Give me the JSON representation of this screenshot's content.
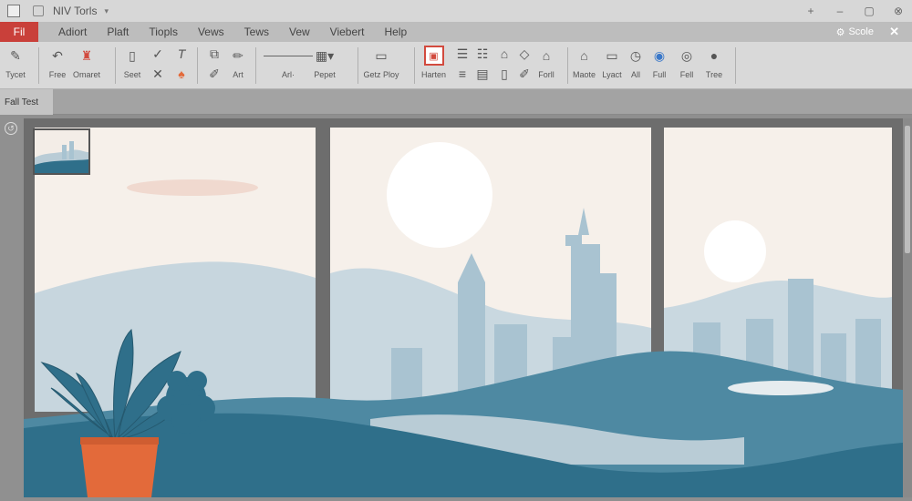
{
  "window": {
    "title": "NIV Torls"
  },
  "menu": {
    "file_tab": "Fil",
    "items": [
      "Adiort",
      "Plaft",
      "Tiopls",
      "Vews",
      "Tews",
      "Vew",
      "Viebert",
      "Help"
    ],
    "scale_label": "Scole"
  },
  "ribbon": {
    "labels": {
      "tycet": "Tycet",
      "free": "Free",
      "omaret": "Omaret",
      "seet": "Seet",
      "art": "Art",
      "arl": "Arl·",
      "pepet": "Pepet",
      "getz_play": "Getz Ploy",
      "harten": "Harten",
      "forll": "Forll",
      "maote": "Maote",
      "lyact": "Lyact",
      "all": "All",
      "full": "Full",
      "fell": "Fell",
      "tree": "Tree"
    }
  },
  "sheet_tab": {
    "label": "Fall Test"
  },
  "colors": {
    "file_tab": "#c9403a",
    "selected_tool": "#d24a3e",
    "frame": "#6d6d6d",
    "sky": "#f6f0ea",
    "teal": "#2f6f8a",
    "teal_light": "#4e89a2",
    "mountain": "#b9ccd6",
    "building": "#a8c3d1",
    "sun": "#ffffff",
    "pot": "#e36a3a",
    "cloud": "#efd6cc"
  },
  "icons": [
    "gear-icon",
    "check-icon",
    "pen-icon",
    "house-icon",
    "globe-icon",
    "undo-icon",
    "close-icon"
  ]
}
